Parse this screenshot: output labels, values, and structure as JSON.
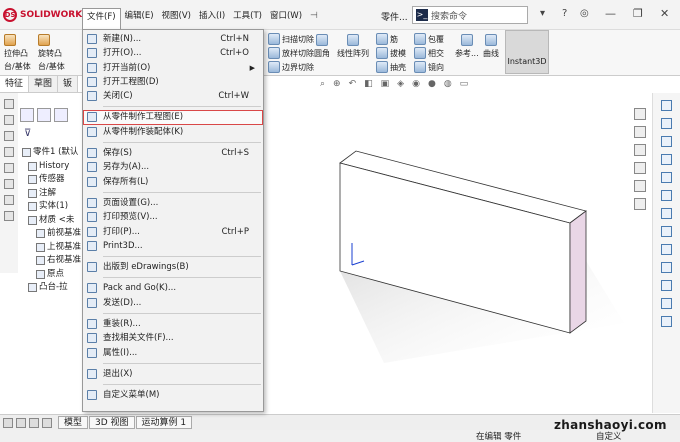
{
  "app": {
    "logo": "SOLIDWORKS",
    "document_name": "零件..."
  },
  "menubar": {
    "items": [
      "文件(F)",
      "编辑(E)",
      "视图(V)",
      "插入(I)",
      "工具(T)",
      "窗口(W)"
    ],
    "pin": "⊣"
  },
  "search": {
    "placeholder": "搜索命令"
  },
  "ribbon": {
    "left": [
      {
        "line1": "拉伸凸",
        "line2": "台/基体"
      },
      {
        "line1": "旋转凸",
        "line2": "台/基体"
      }
    ],
    "items": [
      "扫描切除",
      "放样切除",
      "边界切除",
      "圆角",
      "线性阵列",
      "筋",
      "拔模",
      "抽壳",
      "包覆",
      "相交",
      "镜向",
      "参考...",
      "曲线"
    ],
    "instant3d": "Instant3D"
  },
  "tabs": [
    "特征",
    "草图",
    "钣"
  ],
  "tree": {
    "root": "零件1 (默认",
    "items": [
      "History",
      "传感器",
      "注解",
      "实体(1)",
      "材质 <未",
      "前视基准",
      "上视基准",
      "右视基准",
      "原点",
      "凸台-拉"
    ]
  },
  "file_menu": {
    "groups": [
      [
        {
          "label": "新建(N)...",
          "shortcut": "Ctrl+N"
        },
        {
          "label": "打开(O)...",
          "shortcut": "Ctrl+O"
        },
        {
          "label": "打开当前(O)",
          "arrow": "▶"
        },
        {
          "label": "打开工程图(D)"
        },
        {
          "label": "关闭(C)",
          "shortcut": "Ctrl+W"
        }
      ],
      [
        {
          "label": "从零件制作工程图(E)",
          "highlighted": true
        },
        {
          "label": "从零件制作装配体(K)"
        }
      ],
      [
        {
          "label": "保存(S)",
          "shortcut": "Ctrl+S"
        },
        {
          "label": "另存为(A)..."
        },
        {
          "label": "保存所有(L)"
        }
      ],
      [
        {
          "label": "页面设置(G)..."
        },
        {
          "label": "打印预览(V)..."
        },
        {
          "label": "打印(P)...",
          "shortcut": "Ctrl+P"
        },
        {
          "label": "Print3D..."
        }
      ],
      [
        {
          "label": "出版到 eDrawings(B)"
        }
      ],
      [
        {
          "label": "Pack and Go(K)..."
        },
        {
          "label": "发送(D)..."
        }
      ],
      [
        {
          "label": "重装(R)..."
        },
        {
          "label": "查找相关文件(F)..."
        },
        {
          "label": "属性(I)..."
        }
      ],
      [
        {
          "label": "退出(X)"
        }
      ],
      [
        {
          "label": "自定义菜单(M)"
        }
      ]
    ]
  },
  "bottom_tabs": [
    "模型",
    "3D 视图",
    "运动算例 1"
  ],
  "status": {
    "editing": "在编辑 零件",
    "custom": "自定义"
  },
  "watermark": "zhanshaoyi.com",
  "colors": {
    "logo_red": "#c8102e",
    "highlight_border": "#d94848",
    "box_front": "#ffffff",
    "box_side": "#e9d6e6"
  }
}
